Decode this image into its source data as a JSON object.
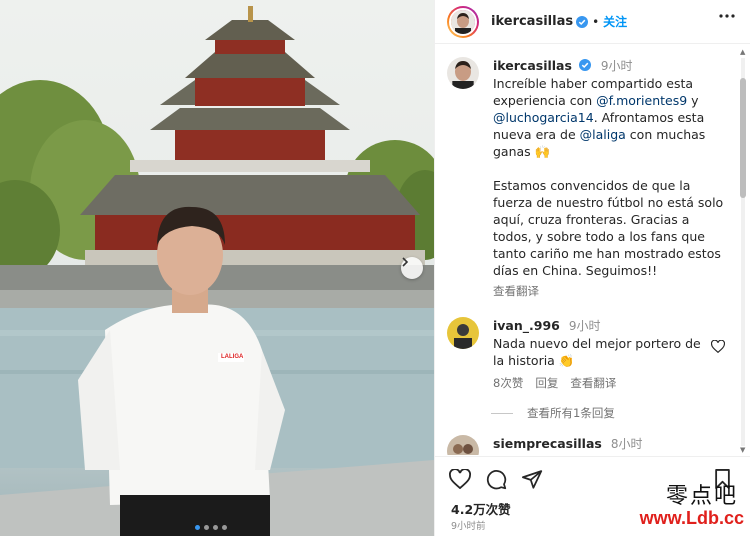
{
  "post": {
    "username": "ikercasillas",
    "follow_label": "关注",
    "caption": {
      "time": "9小时",
      "line1": "Increíble haber compartido esta experiencia con ",
      "mention1": "@f.morientes9",
      "line1b": " y ",
      "mention2": "@luchogarcia14",
      "line2": ". Afrontamos esta nueva era de ",
      "mention3": "@laliga",
      "line2b": " con muchas ganas 🙌",
      "para2": "Estamos convencidos de que la fuerza de nuestro fútbol no está solo aquí, cruza fronteras. Gracias a todos, y sobre todo a los fans que tanto cariño me han mostrado estos días en China. Seguimos!!",
      "translate": "查看翻译"
    },
    "comments": [
      {
        "username": "ivan_.996",
        "time": "9小时",
        "text": "Nada nuevo del mejor portero de la historia 👏",
        "likes": "8次赞",
        "reply": "回复",
        "translate": "查看翻译"
      },
      {
        "username": "siemprecasillas",
        "time": "8小时"
      }
    ],
    "view_replies": "查看所有1条回复",
    "likes": "4.2万次赞",
    "posted": "9小时前",
    "shirt_logo": "LALIGA"
  },
  "watermark": {
    "cn": "零点吧",
    "url": "www.Ldb.cc"
  },
  "colors": {
    "accent": "#0095f6",
    "verified": "#3897f0",
    "mention": "#00376b",
    "secondary": "#737373",
    "watermark_red": "#e0201c"
  },
  "icons": [
    "more-options-icon",
    "verified-icon",
    "heart-icon",
    "comment-icon",
    "share-icon",
    "bookmark-icon",
    "chevron-right-icon"
  ]
}
